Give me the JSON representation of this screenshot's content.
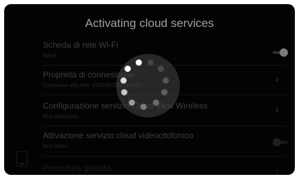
{
  "header": {
    "title": "Activating cloud services"
  },
  "settings": {
    "items": [
      {
        "label": "Scheda di rete Wi-Fi",
        "sub": "Attiva",
        "control": "toggle-on"
      },
      {
        "label": "Proprietà di connessione",
        "sub": "Connesso alla rete: VODAFONE-Nuk23",
        "control": "chevron"
      },
      {
        "label": "Configurazione servizio Cloud View Wireless",
        "sub": "Non associato",
        "control": "chevron"
      },
      {
        "label": "Attivazione servizio cloud videocitofonico",
        "sub": "Non attivo",
        "control": "toggle-off"
      },
      {
        "label": "Procedura guidata",
        "sub": "",
        "control": "chevron"
      }
    ]
  },
  "icons": {
    "chevron": "chevron-right-icon",
    "spinner": "loading-spinner-icon",
    "device": "device-icon"
  },
  "colors": {
    "background": "#050505",
    "title": "#f2f2f2",
    "spinner_dot_active": "#ffffff",
    "spinner_dot_dim": "#6a6a6a"
  }
}
